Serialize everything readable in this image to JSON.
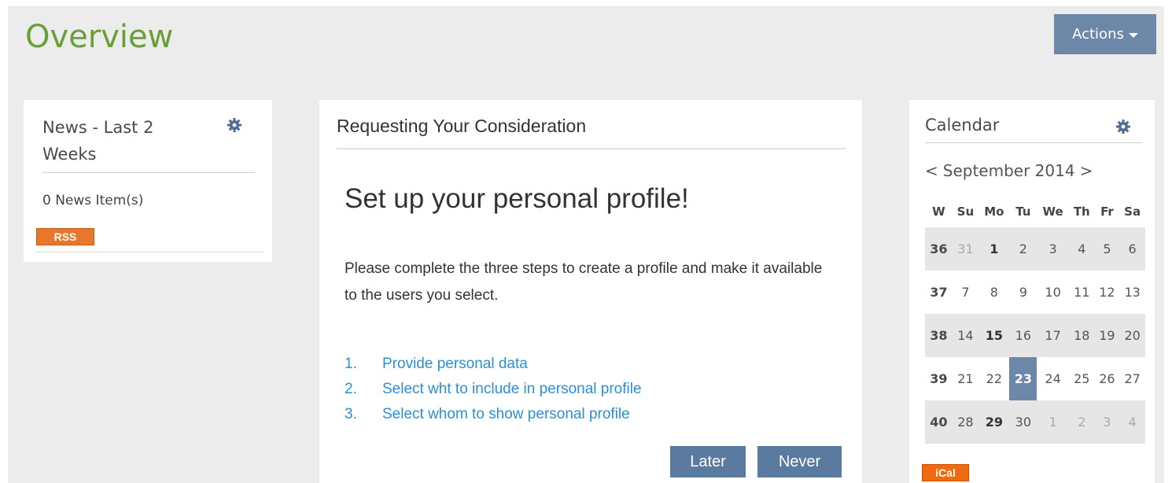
{
  "header": {
    "title": "Overview",
    "actions_label": "Actions"
  },
  "news": {
    "title": "News - Last 2 Weeks",
    "count": "0 News Item(s)",
    "rss_label": "RSS"
  },
  "consideration": {
    "header": "Requesting Your Consideration",
    "title": "Set up your personal profile!",
    "description": "Please complete the three steps to create a profile and make it available to the users you select.",
    "steps": [
      {
        "num": "1.",
        "label": "Provide personal data"
      },
      {
        "num": "2.",
        "label": "Select wht to include in personal profile"
      },
      {
        "num": "3.",
        "label": "Select whom to show personal profile"
      }
    ],
    "later_label": "Later",
    "never_label": "Never"
  },
  "calendar": {
    "title": "Calendar",
    "prev": "<",
    "month_year": "September 2014",
    "next": ">",
    "day_headers": [
      "W",
      "Su",
      "Mo",
      "Tu",
      "We",
      "Th",
      "Fr",
      "Sa"
    ],
    "weeks": [
      {
        "week": "36",
        "days": [
          "31",
          "1",
          "2",
          "3",
          "4",
          "5",
          "6"
        ]
      },
      {
        "week": "37",
        "days": [
          "7",
          "8",
          "9",
          "10",
          "11",
          "12",
          "13"
        ]
      },
      {
        "week": "38",
        "days": [
          "14",
          "15",
          "16",
          "17",
          "18",
          "19",
          "20"
        ]
      },
      {
        "week": "39",
        "days": [
          "21",
          "22",
          "23",
          "24",
          "25",
          "26",
          "27"
        ]
      },
      {
        "week": "40",
        "days": [
          "28",
          "29",
          "30",
          "1",
          "2",
          "3",
          "4"
        ]
      }
    ],
    "ical_label": "iCal",
    "colors": {
      "today": "#6d87a8",
      "accent": "#6a9e3a"
    }
  }
}
